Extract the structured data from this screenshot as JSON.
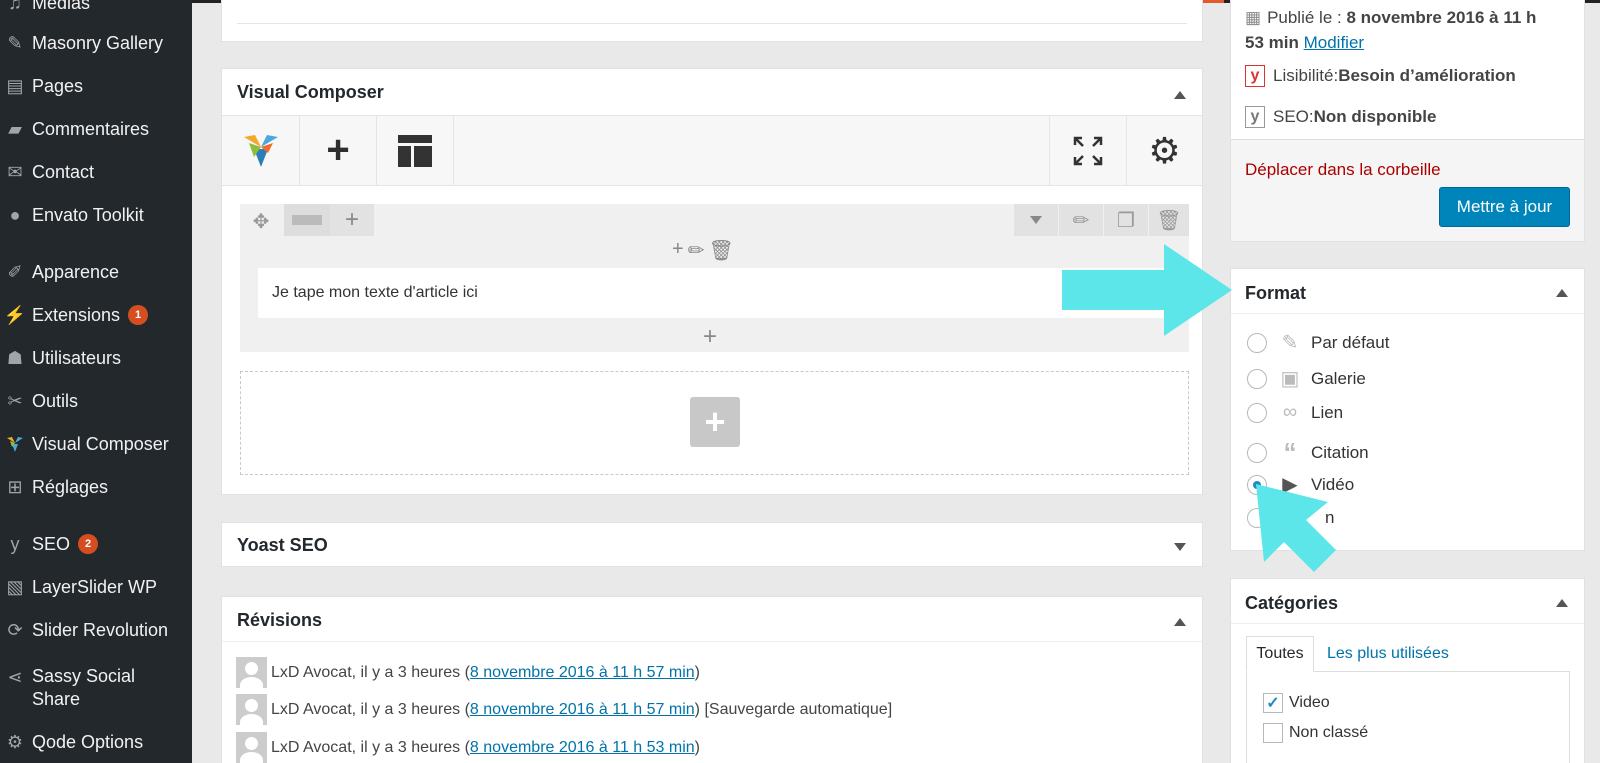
{
  "sidebar": {
    "items": [
      {
        "label": "Médias",
        "icon": "media-icon"
      },
      {
        "label": "Masonry Gallery",
        "icon": "pin-icon"
      },
      {
        "label": "Pages",
        "icon": "pages-icon"
      },
      {
        "label": "Commentaires",
        "icon": "comment-icon"
      },
      {
        "label": "Contact",
        "icon": "mail-icon"
      },
      {
        "label": "Envato Toolkit",
        "icon": "leaf-icon"
      },
      {
        "label": "Apparence",
        "icon": "brush-icon"
      },
      {
        "label": "Extensions",
        "icon": "plugin-icon",
        "badge": "1"
      },
      {
        "label": "Utilisateurs",
        "icon": "user-icon"
      },
      {
        "label": "Outils",
        "icon": "wrench-icon"
      },
      {
        "label": "Visual Composer",
        "icon": "vc-icon"
      },
      {
        "label": "Réglages",
        "icon": "settings-icon"
      },
      {
        "label": "SEO",
        "icon": "yoast-icon",
        "badge": "2"
      },
      {
        "label": "LayerSlider WP",
        "icon": "layers-icon"
      },
      {
        "label": "Slider Revolution",
        "icon": "refresh-icon"
      },
      {
        "label": "Sassy Social Share",
        "icon": "share-icon"
      },
      {
        "label": "Qode Options",
        "icon": "gear-icon"
      }
    ]
  },
  "visual_composer": {
    "title": "Visual Composer",
    "text_block": "Je tape mon texte d'article ici"
  },
  "yoast": {
    "title": "Yoast SEO"
  },
  "revisions": {
    "title": "Révisions",
    "rows": [
      {
        "author": "LxD Avocat, il y a 3 heures (",
        "date": "8 novembre 2016 à 11 h 57 min",
        "suffix": ")"
      },
      {
        "author": "LxD Avocat, il y a 3 heures (",
        "date": "8 novembre 2016 à 11 h 57 min",
        "suffix": ") [Sauvegarde automatique]"
      },
      {
        "author": "LxD Avocat, il y a 3 heures (",
        "date": "8 novembre 2016 à 11 h 53 min",
        "suffix": ")"
      }
    ]
  },
  "publish": {
    "published_label": "Publié le : ",
    "published_value": "8 novembre 2016 à 11 h",
    "published_value2": "53 min",
    "modify_link": "Modifier",
    "readability_label": "Lisibilité: ",
    "readability_value": "Besoin d’amélioration",
    "seo_label": "SEO: ",
    "seo_value": "Non disponible",
    "trash_link": "Déplacer dans la corbeille",
    "update_button": "Mettre à jour"
  },
  "format": {
    "title": "Format",
    "options": [
      {
        "label": "Par défaut",
        "icon": "pin-icon",
        "selected": false
      },
      {
        "label": "Galerie",
        "icon": "gallery-icon",
        "selected": false
      },
      {
        "label": "Lien",
        "icon": "link-icon",
        "selected": false
      },
      {
        "label": "Citation",
        "icon": "quote-icon",
        "selected": false
      },
      {
        "label": "Vidéo",
        "icon": "video-icon",
        "selected": true
      },
      {
        "label": "n",
        "icon": "",
        "selected": false
      }
    ]
  },
  "categories": {
    "title": "Catégories",
    "tab_all": "Toutes",
    "tab_most_used": "Les plus utilisées",
    "items": [
      {
        "label": "Video",
        "checked": true
      },
      {
        "label": "Non classé",
        "checked": false
      }
    ]
  },
  "colors": {
    "arrow": "#5ce6ea",
    "primary_button": "#0085ba",
    "trash": "#a00",
    "link": "#0073aa"
  }
}
